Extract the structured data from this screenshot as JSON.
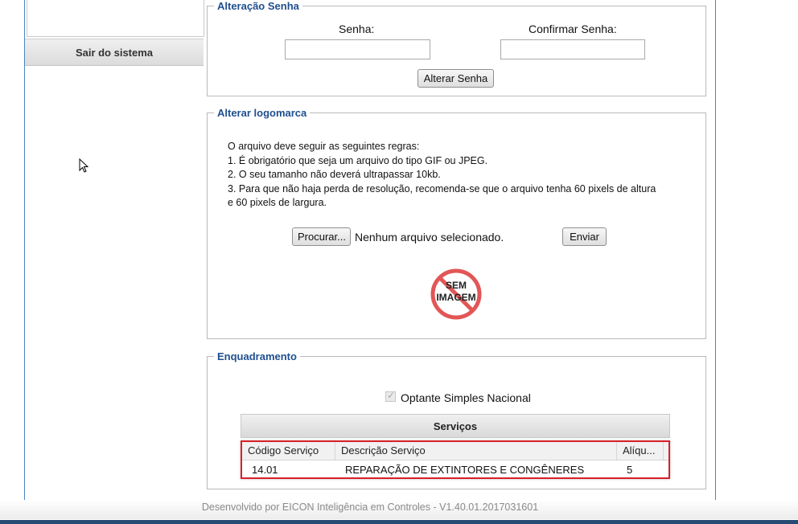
{
  "sidebar": {
    "exit_label": "Sair do sistema"
  },
  "password_section": {
    "legend": "Alteração Senha",
    "password_label": "Senha:",
    "confirm_label": "Confirmar Senha:",
    "password_value": "",
    "confirm_value": "",
    "submit_label": "Alterar Senha"
  },
  "logo_section": {
    "legend": "Alterar logomarca",
    "rules": [
      "O arquivo deve seguir as seguintes regras:",
      "1. É obrigatório que seja um arquivo do tipo GIF ou JPEG.",
      "2. O seu tamanho não deverá ultrapassar 10kb.",
      "3. Para que não haja perda de resolução, recomenda-se que o arquivo tenha 60 pixels de altura",
      "e 60 pixels de largura."
    ],
    "browse_label": "Procurar...",
    "file_status": "Nenhum arquivo selecionado.",
    "send_label": "Enviar",
    "placeholder_line1": "SEM",
    "placeholder_line2": "IMAGEM"
  },
  "framing_section": {
    "legend": "Enquadramento",
    "simples_label": "Optante Simples Nacional",
    "simples_checked": true,
    "services_title": "Serviços",
    "columns": [
      "Código Serviço",
      "Descrição Serviço",
      "Alíqu..."
    ],
    "rows": [
      {
        "code": "14.01",
        "description": "REPARAÇÃO DE EXTINTORES E CONGÊNERES",
        "rate": "5"
      }
    ]
  },
  "footer": {
    "text": "Desenvolvido por EICON Inteligência em Controles - V1.40.01.2017031601"
  },
  "colors": {
    "legend": "#1f4f8f",
    "frame_border": "#4a86c5",
    "highlight": "#d9202a",
    "bottom_bar": "#264a73"
  }
}
